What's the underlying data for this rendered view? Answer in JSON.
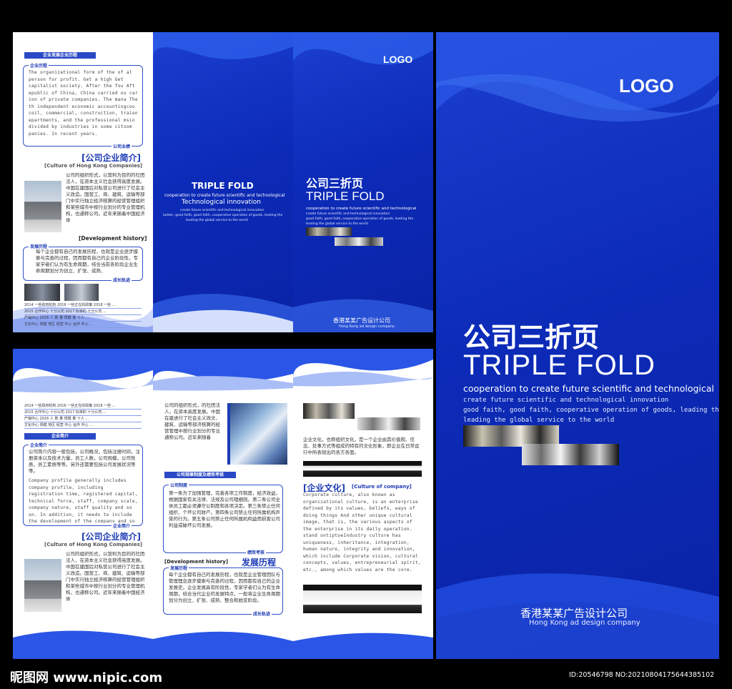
{
  "brochure_top": {
    "left_panel": {
      "bar_title": "企业发展企业历程",
      "box_tag": "企业历程",
      "box_text": "The organizational form of the of al person for profit. Get a high Get capitalist society. After the fou Aft epublic of China, China carried ou car ion of private companies. The mana The th independent economic accountingcou coil, commercial, construction, traion epartments, and the professional msio divided by industries in some citsom panies. In recent years.",
      "box_tail": "公司业绩",
      "heading": "[公司企业简介]",
      "heading_en": "[Culture of Hong Kong Companies]",
      "intro_text": "公司的组织形式，以营利为目的的社团法人，在资本主义社会获得高度发展。中国在建国后对私营公司进行了社会主义改造。国营工、商、建筑、运输等部门中实行独立经济核算的经营管理组织和某些城市中按行业划分的专业管理机构，也通称公司。近年来随着中国经济体",
      "dev_tag": "发展历程",
      "dev_heading": "[Development history]",
      "dev_text": "每个企业都有自己的发展历程，也就是企业逐步摸索与完善的过程，因而都有自己的企业阶段性，专家学者们认为有生命周期，结合当前各阶段企业生命周期划分为创立、扩张、成熟、",
      "dev_tail": "成长轨迹",
      "table_rows": [
        "2014 一些政府机构  2016 一些正在的政策  2018 一些  ...",
        "2015 合作中心 十分公司  2017 标准的 十分公司  ...",
        "产销中心  2016 人 数 量 规模 量 十人 ...",
        "文化中心  规模 地区  经营 中心  运作 中心 ..."
      ]
    },
    "middle_panel": {
      "title": "TRIPLE FOLD",
      "line1": "cooperation to create future scientific and technological",
      "line2": "Technological innovation",
      "line3": "create future scientific and technological innovation",
      "line4": "ladder, good faith, good faith, cooperative operation of goods, leading the",
      "line5": "leading the global service to the world"
    },
    "right_panel": {
      "logo": "LOGO",
      "title_cn": "公司三折页",
      "title_en": "TRIPLE FOLD",
      "line1": "cooperation to create future scientific and technological",
      "line2": "create future scientific and technological innovation",
      "line3": "good faith, good faith, cooperative operation of goods, leading the",
      "line4": "leading the global service to the world",
      "company_cn": "香港某某广告设计公司",
      "company_en": "Hong Kong ad design company"
    }
  },
  "brochure_bottom": {
    "left_panel": {
      "bar_title": "企业简介",
      "box_tag": "企业简介",
      "box_text_cn": "公司简介内容一般包括，公司概况，包括注册时间，注册资本以及技术力量，员工人数，公司规模，公司性质，员工素质等等。另外还需要包括公司发展状况等等。",
      "box_text_en": "Company profile generally includes company profile, including registration time, registered capital, technical force, staff, company scale, company nature, staff quality and so on. In addition, it needs to include the development of the company and so on.",
      "box_tail": "企业简介",
      "heading": "[公司企业简介]",
      "heading_en": "[Culture of Hong Kong Companies]",
      "intro_text": "公司的组织形式，以营利为目的的社团法人，在资本主义社会获得高度发展。中国在建国后对私营公司进行了社会主义改造。国营工、商、建筑、运输等部门中实行独立经济核算的经营管理组织和某些城市中按行业划分的专业管理机构，也通称公司。近年来随着中国经济体"
    },
    "middle_panel": {
      "top_text": "公司的组织形式，的社团法人，在资本高度发展。中国在建进行了社会主义改文、建筑、运输等部济核算的经营管理中按行业划分的专业通称公司。近年来随着",
      "bar_title": "公司规章制度及绩效考核",
      "box_tag": "公司制度",
      "box_text": "第一条为了加强管理，完善各项工作制度，经济效益，根据国家有关法律、法规及公司理细则。第二条公司全体员工都必须遵守公制度和各项决定。第三条禁止任何组织、个坏公司财产。第四条公司禁止任何所属机构声誉的行为。第五条公司禁止任何所属机构益而损害公司利益或破坏公司发展。",
      "box_tail": "绩效考核",
      "dev_heading_en": "[Development history]",
      "dev_heading_cn": "发展历程",
      "dev_tag": "发展历程",
      "dev_text": "每个企业都有自己的发展历程，也就是企业管理团队与管理理念逐步摸索与完善的过程，因而都有自己的企业发展史。企业发展具有阶段性，专家学者们认为有生命周期，结合当代企业的发展特点，一般将企业生命周期划分为创立、扩张、成熟、整合和蜕变阶段。",
      "dev_tail": "成长轨迹"
    },
    "right_panel": {
      "culture_text_cn": "企业文化，也称组织文化，是一个企业由其价值观、信念、处事方式等组成的特有的文化形象，即企业在日常运行中所表现出的各方各面。",
      "heading_cn": "[企业文化]",
      "heading_en": "[Culture of company]",
      "culture_text_en": "Corporate culture, also known as organizational culture, is an enterprise defined by its values, beliefs, ways of doing things And other unique cultural image, that is, the various aspects of the enterprise in its daily operation. stand ontiptoeIndustry culture has uniqueness, inheritance, integration, human nature, integrity and innovation, which include Corporate vision, cultural concepts, values, entrepreneurial spirit, etc., among which values are the core."
    }
  },
  "cover": {
    "logo": "LOGO",
    "title_cn": "公司三折页",
    "title_en": "TRIPLE FOLD",
    "line1": "cooperation to create future scientific and technological",
    "line2": "create future scientific and technological innovation",
    "line3": "good faith, good faith, cooperative operation of goods, leading the",
    "line4": "leading the global service to the world",
    "company_cn": "香港某某广告设计公司",
    "company_en": "Hong Kong ad design company"
  },
  "watermark": {
    "site": "昵图网 www.nipic.com",
    "id": "ID:20546798 NO:20210804175644385102"
  },
  "colors": {
    "accent": "#1d3bb5",
    "background": "#000000",
    "panel_blue": "#0c2bb8"
  }
}
